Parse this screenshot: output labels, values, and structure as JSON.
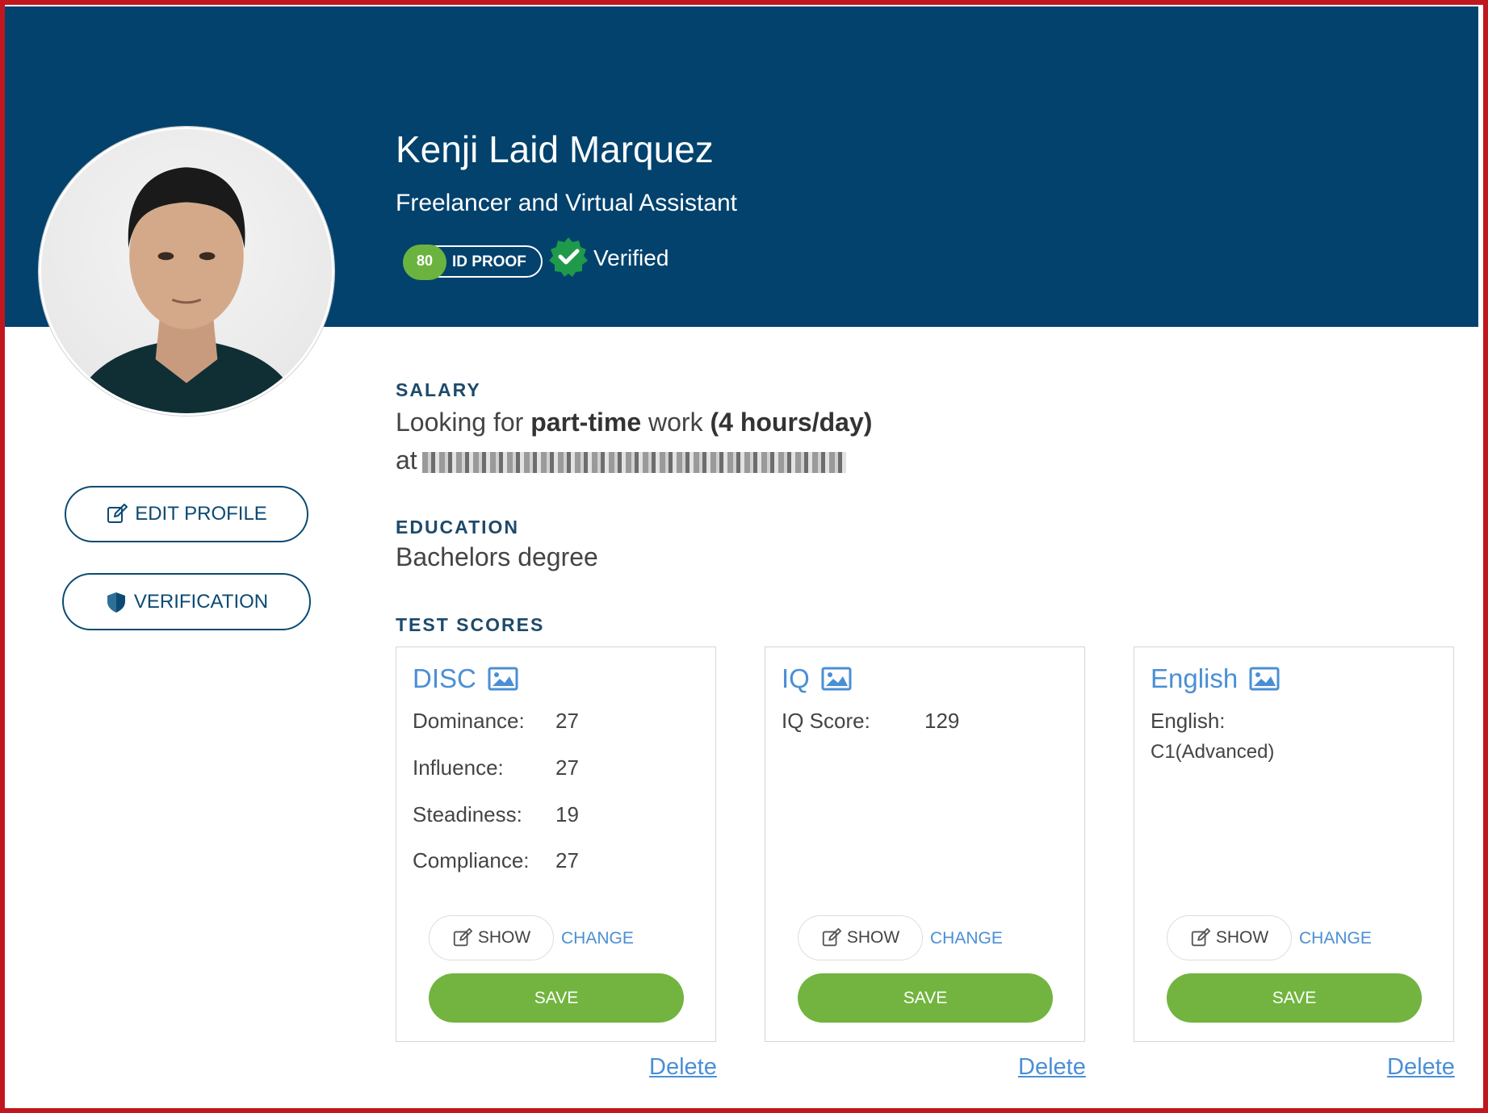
{
  "profile": {
    "name": "Kenji Laid Marquez",
    "headline": "Freelancer and Virtual Assistant",
    "id_proof_score": "80",
    "id_proof_label": "ID PROOF",
    "verified_label": "Verified"
  },
  "side_actions": {
    "edit_profile": "EDIT PROFILE",
    "verification": "VERIFICATION"
  },
  "salary": {
    "label": "SALARY",
    "prefix": "Looking for ",
    "work_type": "part-time",
    "middle": " work ",
    "hours": "(4 hours/day)",
    "at": "at"
  },
  "education": {
    "label": "EDUCATION",
    "value": "Bachelors degree"
  },
  "test_scores": {
    "label": "TEST SCORES",
    "cards": [
      {
        "title": "DISC",
        "rows": [
          {
            "label": "Dominance:",
            "value": "27"
          },
          {
            "label": "Influence:",
            "value": "27"
          },
          {
            "label": "Steadiness:",
            "value": "19"
          },
          {
            "label": "Compliance:",
            "value": "27"
          }
        ],
        "show_label": "SHOW",
        "change_label": "CHANGE",
        "save_label": "SAVE",
        "delete_label": "Delete"
      },
      {
        "title": "IQ",
        "rows": [
          {
            "label": "IQ Score:",
            "value": "129"
          }
        ],
        "show_label": "SHOW",
        "change_label": "CHANGE",
        "save_label": "SAVE",
        "delete_label": "Delete"
      },
      {
        "title": "English",
        "rows": [
          {
            "label": "English:",
            "value": "C1(Advanced)"
          }
        ],
        "show_label": "SHOW",
        "change_label": "CHANGE",
        "save_label": "SAVE",
        "delete_label": "Delete"
      }
    ]
  },
  "colors": {
    "banner": "#02426d",
    "accent_blue": "#4a8fd6",
    "save_green": "#72b43f",
    "badge_green": "#6bb33f",
    "frame_red": "#c0171e"
  },
  "icons": {
    "edit": "edit-icon",
    "shield": "shield-icon",
    "verified": "verified-badge-icon",
    "image": "image-icon"
  }
}
